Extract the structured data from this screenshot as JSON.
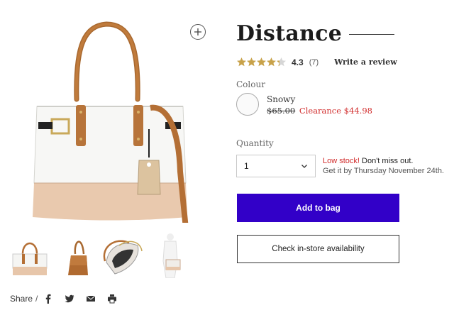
{
  "product": {
    "title": "Distance",
    "rating": "4.3",
    "rating_stars": 4.3,
    "review_count": "(7)",
    "write_review_label": "Write a review"
  },
  "colour": {
    "label": "Colour",
    "selected_name": "Snowy",
    "old_price": "$65.00",
    "clearance_price": "Clearance $44.98"
  },
  "quantity": {
    "label": "Quantity",
    "value": "1"
  },
  "stock": {
    "low_stock": "Low stock!",
    "message": " Don't miss out.",
    "delivery": "Get it by Thursday November 24th."
  },
  "actions": {
    "add_to_bag": "Add to bag",
    "check_store": "Check in-store availability"
  },
  "share": {
    "label": "Share",
    "separator": "/",
    "icons": [
      "facebook-icon",
      "twitter-icon",
      "email-icon",
      "print-icon"
    ]
  },
  "colors": {
    "primary_button": "#3200c8",
    "sale_red": "#d12b2b",
    "star_gold": "#c8a24a"
  }
}
